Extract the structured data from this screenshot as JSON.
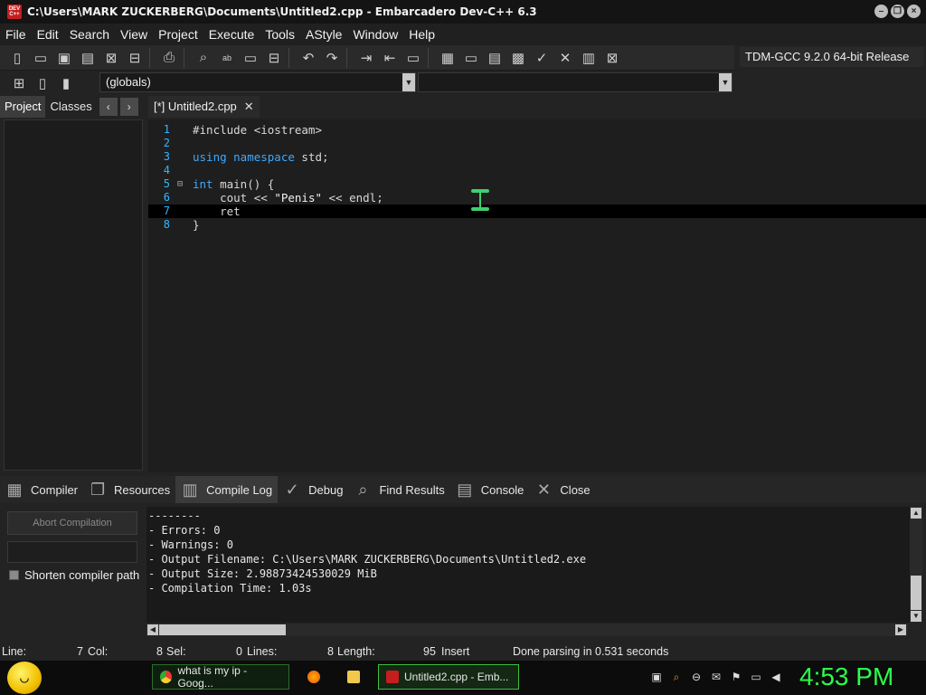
{
  "window": {
    "title": "C:\\Users\\MARK ZUCKERBERG\\Documents\\Untitled2.cpp - Embarcadero Dev-C++ 6.3",
    "app_icon_text": "DEV C++"
  },
  "menu": [
    "File",
    "Edit",
    "Search",
    "View",
    "Project",
    "Execute",
    "Tools",
    "AStyle",
    "Window",
    "Help"
  ],
  "toolbar": {
    "compiler": "TDM-GCC 9.2.0 64-bit Release",
    "globals": "(globals)"
  },
  "left_panel": {
    "tabs": [
      "Project",
      "Classes"
    ],
    "active_tab": "Project"
  },
  "editor": {
    "tab_label": "[*] Untitled2.cpp",
    "lines": [
      {
        "n": "1",
        "text": "#include <iostream>"
      },
      {
        "n": "2",
        "text": ""
      },
      {
        "n": "3",
        "kw": "using namespace",
        "rest": " std;"
      },
      {
        "n": "4",
        "text": ""
      },
      {
        "n": "5",
        "kw": "int",
        "rest": " main() {"
      },
      {
        "n": "6",
        "pre": "    cout << ",
        "str": "\"Penis\"",
        "post": " << endl;"
      },
      {
        "n": "7",
        "text": "    ret"
      },
      {
        "n": "8",
        "text": "}"
      }
    ]
  },
  "bottom_panel": {
    "tabs": [
      "Compiler",
      "Resources",
      "Compile Log",
      "Debug",
      "Find Results",
      "Console",
      "Close"
    ],
    "active_tab": "Compile Log",
    "abort_label": "Abort Compilation",
    "shorten_label": "Shorten compiler path",
    "log": [
      "--------",
      "- Errors: 0",
      "- Warnings: 0",
      "- Output Filename: C:\\Users\\MARK ZUCKERBERG\\Documents\\Untitled2.exe",
      "- Output Size: 2.98873424530029 MiB",
      "- Compilation Time: 1.03s"
    ]
  },
  "status": {
    "line_label": "Line:",
    "line_val": "7",
    "col_label": "Col:",
    "col_val": "8",
    "sel_label": "Sel:",
    "sel_val": "0",
    "lines_label": "Lines:",
    "lines_val": "8",
    "length_label": "Length:",
    "length_val": "95",
    "mode": "Insert",
    "message": "Done parsing in 0.531 seconds"
  },
  "taskbar": {
    "tasks": [
      "what is my ip - Goog...",
      "Untitled2.cpp - Emb..."
    ],
    "clock": "4:53 PM",
    "accent": "#2bff4a"
  }
}
